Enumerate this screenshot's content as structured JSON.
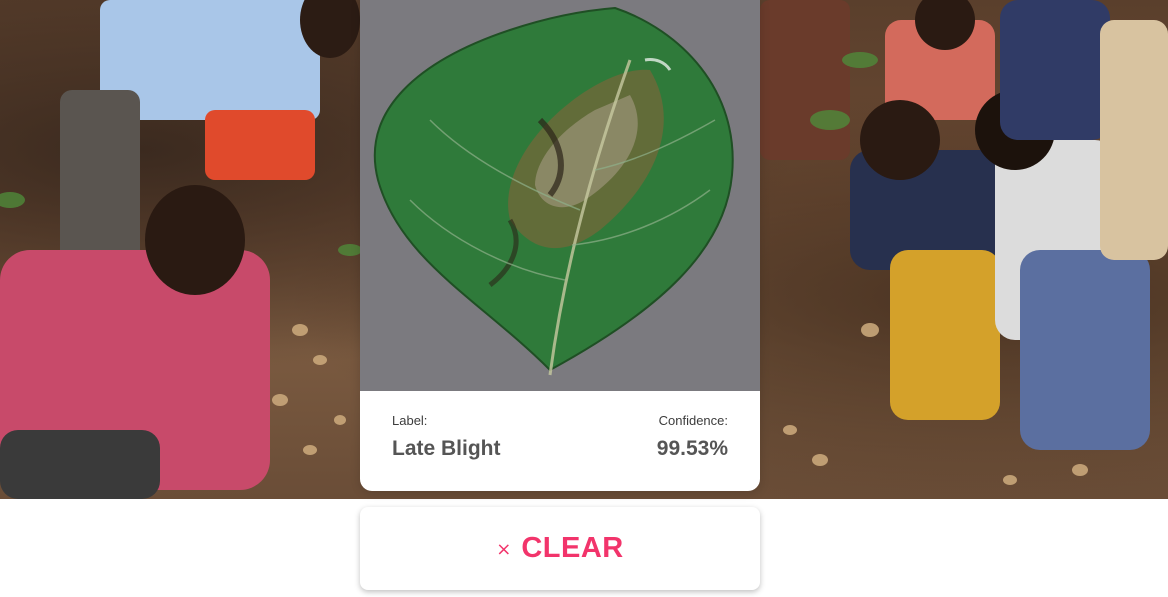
{
  "result": {
    "label_title": "Label:",
    "label_value": "Late Blight",
    "confidence_title": "Confidence:",
    "confidence_value": "99.53%"
  },
  "clear_button": {
    "icon": "×",
    "label": "CLEAR"
  },
  "colors": {
    "accent": "#f2346b",
    "text_dark": "#555555",
    "leaf_green": "#2f7a3a",
    "background_photo": "#6b4a33"
  }
}
